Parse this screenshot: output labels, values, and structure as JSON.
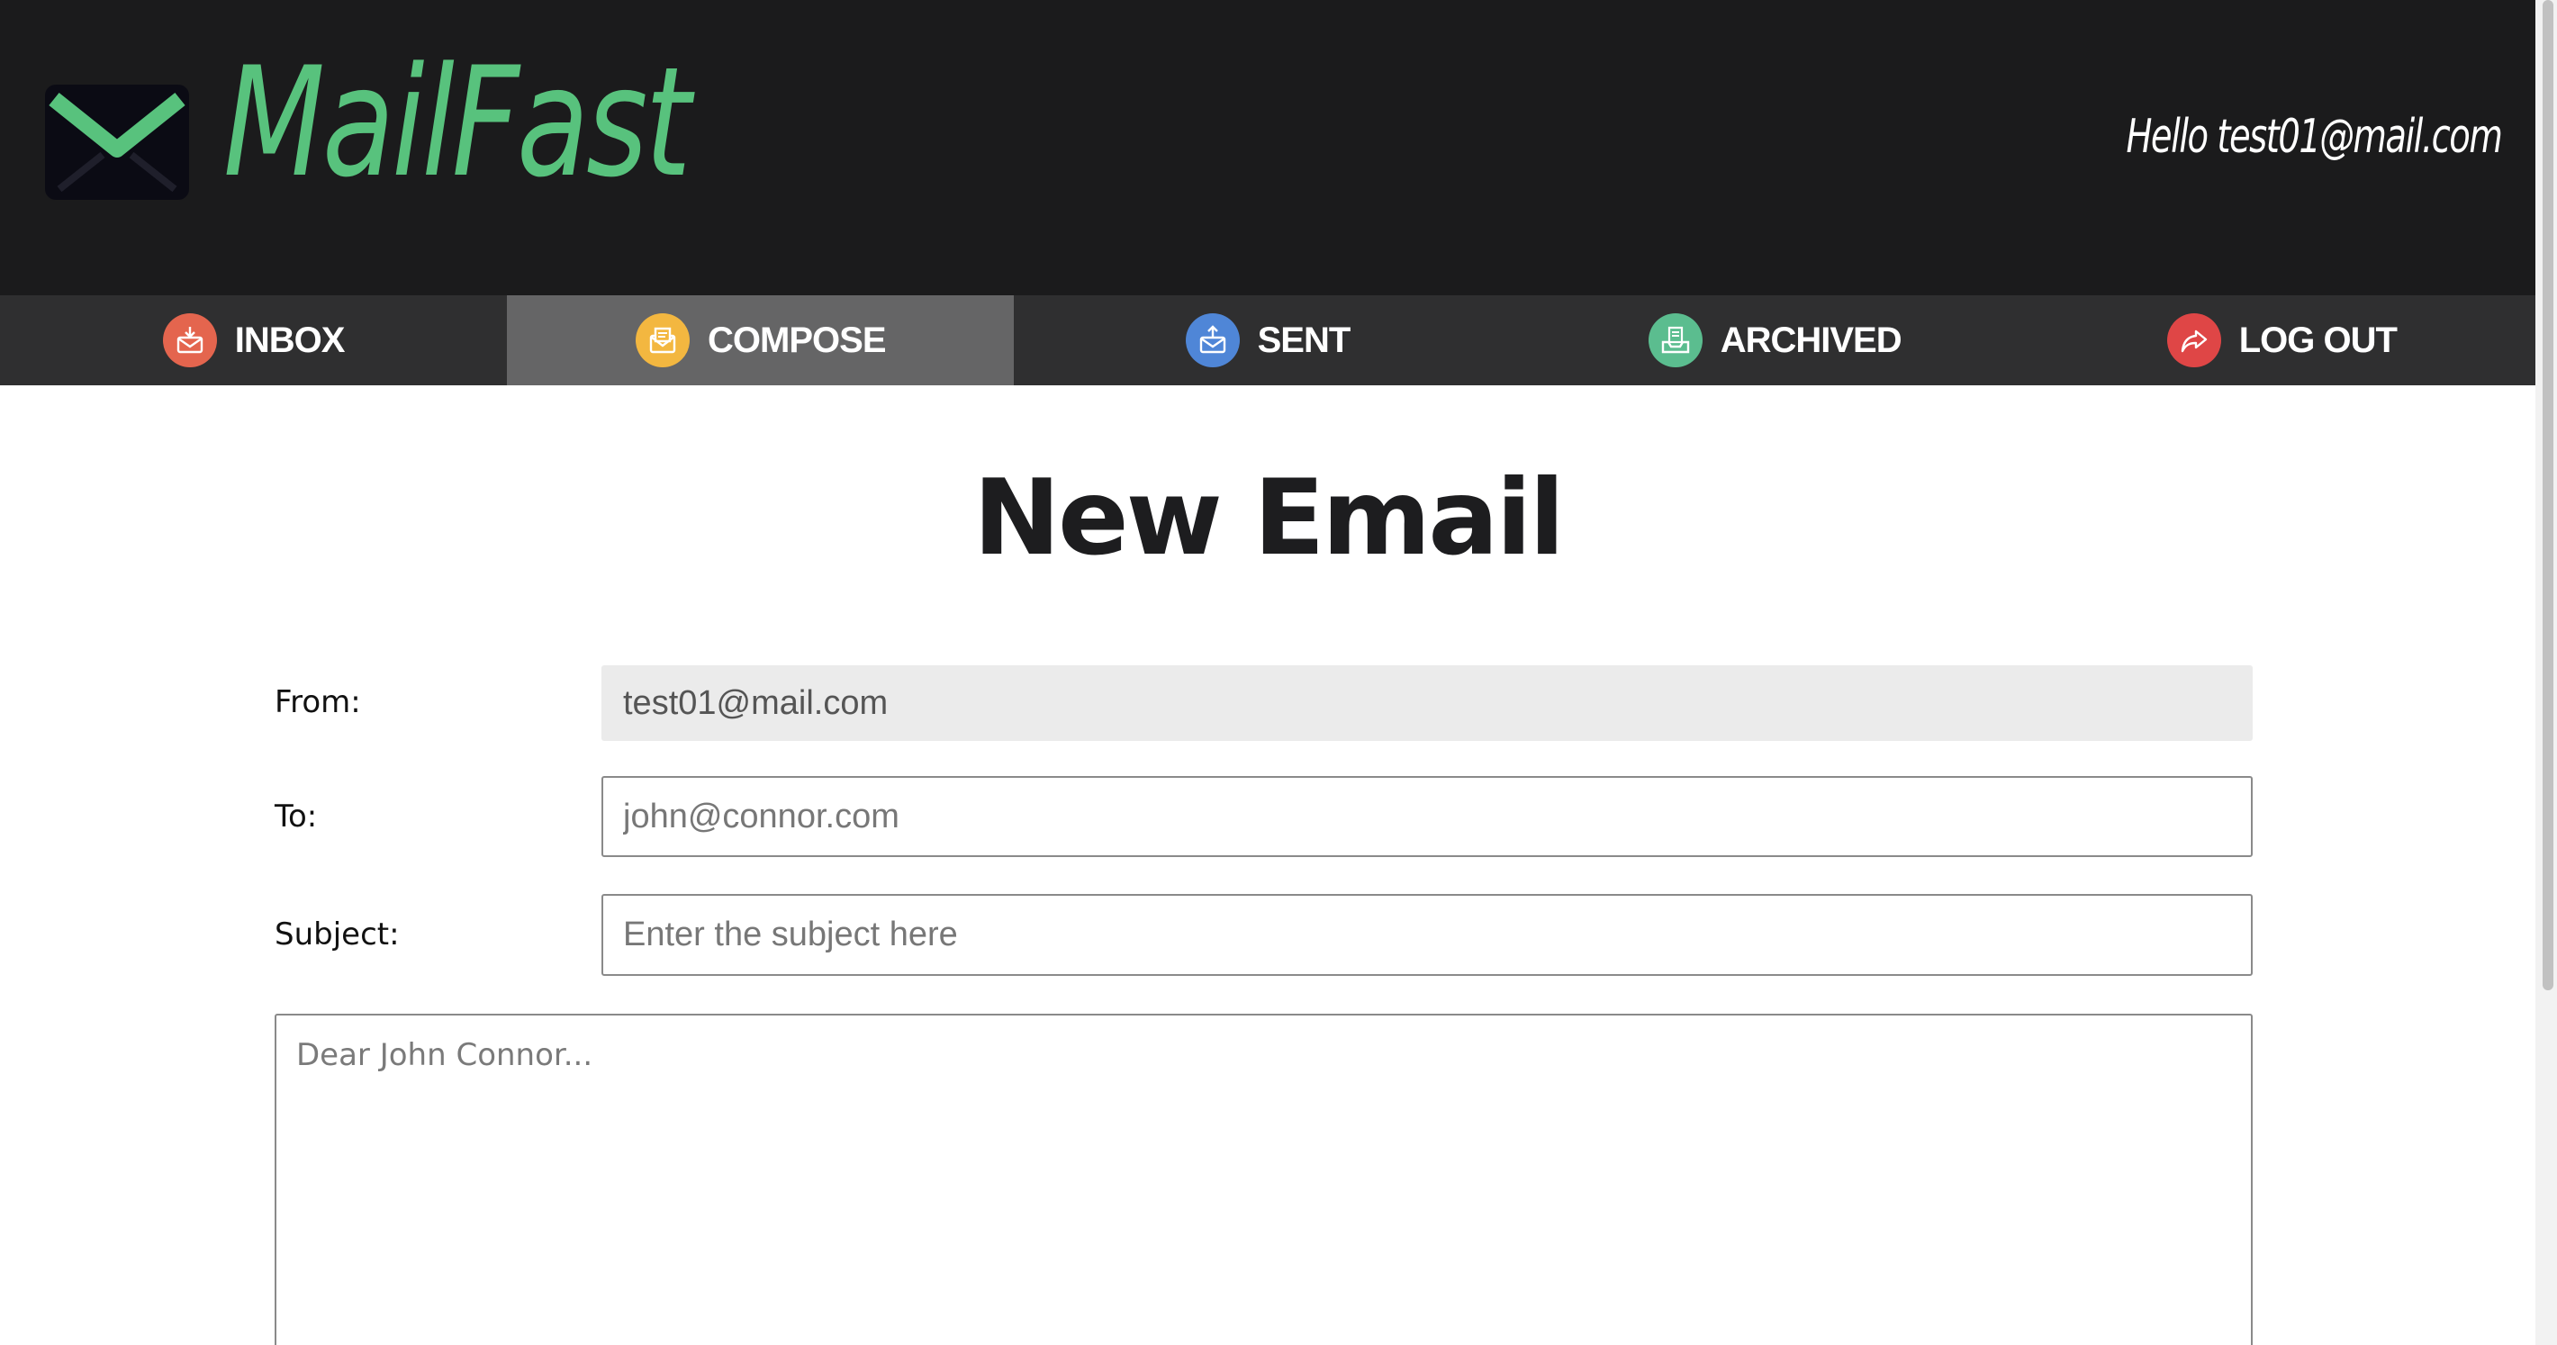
{
  "header": {
    "logo_text": "MailFast",
    "greeting": "Hello test01@mail.com"
  },
  "nav": [
    {
      "label": "INBOX",
      "icon": "inbox-download-icon",
      "color": "#e4654e",
      "active": false
    },
    {
      "label": "COMPOSE",
      "icon": "compose-letter-icon",
      "color": "#f3b740",
      "active": true
    },
    {
      "label": "SENT",
      "icon": "sent-upload-icon",
      "color": "#4f86d7",
      "active": false
    },
    {
      "label": "ARCHIVED",
      "icon": "archive-tray-icon",
      "color": "#5bbd8f",
      "active": false
    },
    {
      "label": "LOG OUT",
      "icon": "logout-arrow-icon",
      "color": "#df4646",
      "active": false
    }
  ],
  "page": {
    "title": "New Email"
  },
  "form": {
    "from_label": "From:",
    "from_value": "test01@mail.com",
    "to_label": "To:",
    "to_placeholder": "john@connor.com",
    "subject_label": "Subject:",
    "subject_placeholder": "Enter the subject here",
    "body_placeholder": "Dear John Connor..."
  },
  "colors": {
    "header_bg": "#1b1b1c",
    "nav_bg": "#2f2f30",
    "nav_active_bg": "#656566",
    "brand_green": "#58c27d"
  }
}
